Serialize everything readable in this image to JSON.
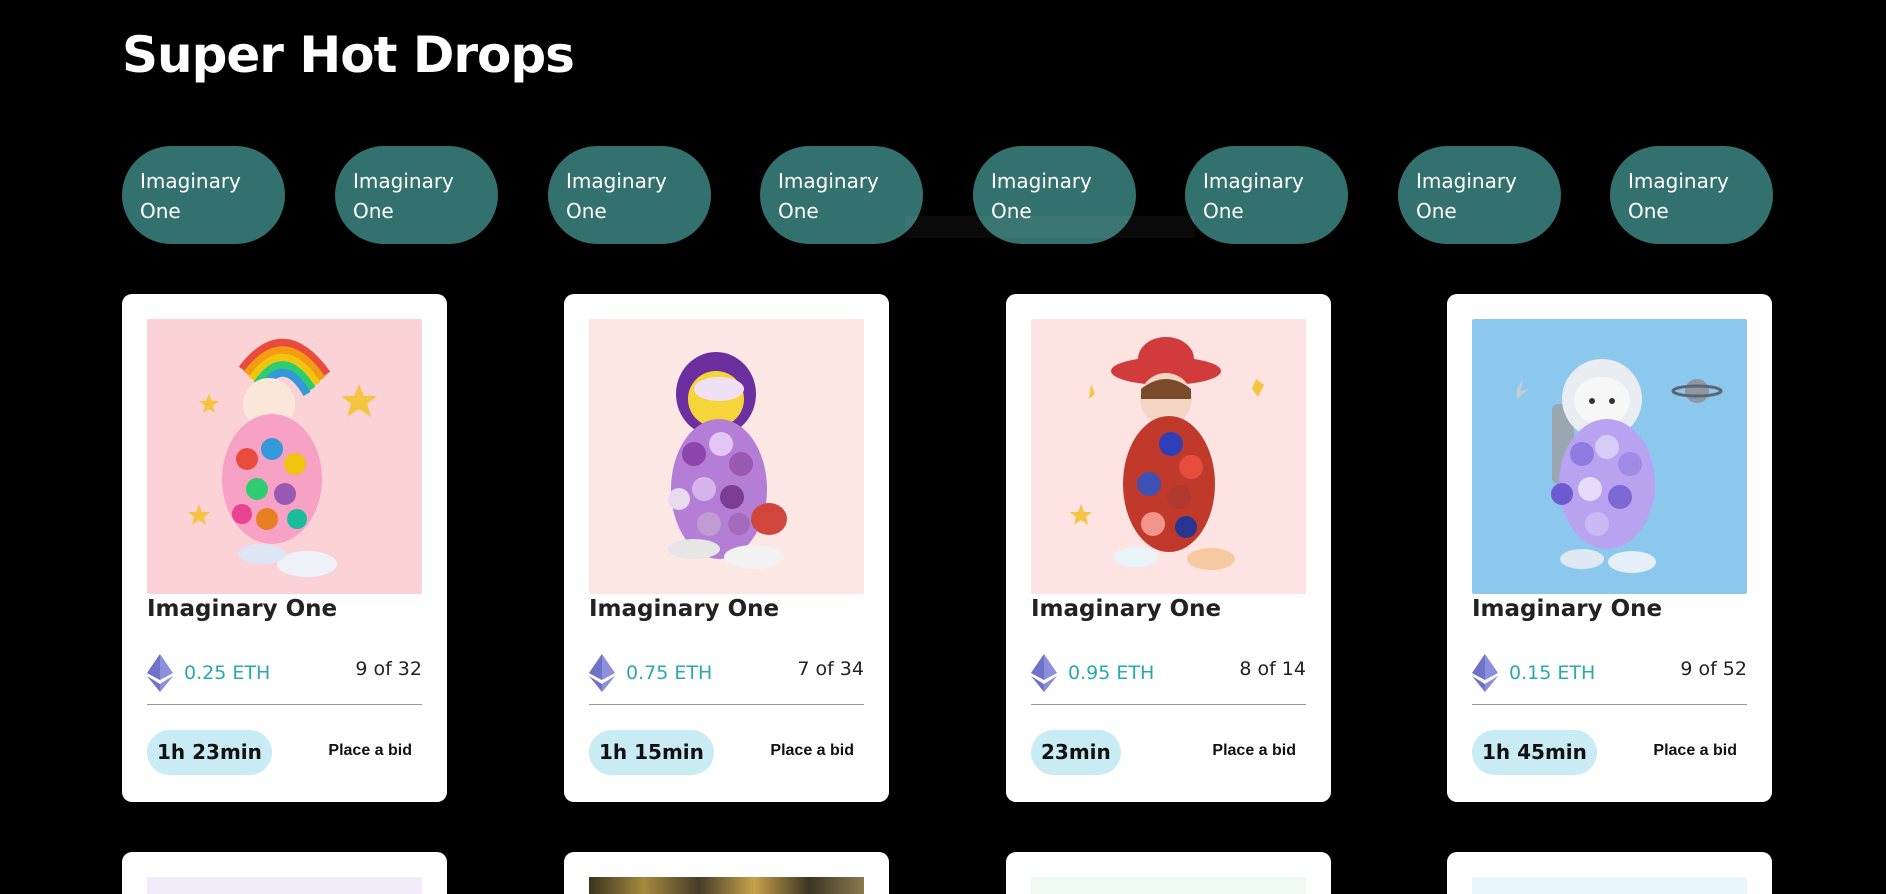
{
  "page": {
    "title": "Super Hot Drops"
  },
  "filters": [
    {
      "label": "Imaginary One"
    },
    {
      "label": "Imaginary One"
    },
    {
      "label": "Imaginary One"
    },
    {
      "label": "Imaginary One"
    },
    {
      "label": "Imaginary One"
    },
    {
      "label": "Imaginary One"
    },
    {
      "label": "Imaginary One"
    },
    {
      "label": "Imaginary One"
    }
  ],
  "cards": [
    {
      "name": "Imaginary One",
      "price": "0.25 ETH",
      "edition": "9 of 32",
      "timer": "1h 23min",
      "bid_label": "Place a bid",
      "currency_icon": "ethereum-icon",
      "image_bg": "#fbd3d6"
    },
    {
      "name": "Imaginary One",
      "price": "0.75 ETH",
      "edition": "7 of 34",
      "timer": "1h 15min",
      "bid_label": "Place a bid",
      "currency_icon": "ethereum-icon",
      "image_bg": "#fce7e5"
    },
    {
      "name": "Imaginary One",
      "price": "0.95 ETH",
      "edition": "8 of 14",
      "timer": "23min",
      "bid_label": "Place a bid",
      "currency_icon": "ethereum-icon",
      "image_bg": "#fde3e1"
    },
    {
      "name": "Imaginary One",
      "price": "0.15 ETH",
      "edition": "9 of 52",
      "timer": "1h 45min",
      "bid_label": "Place a bid",
      "currency_icon": "ethereum-icon",
      "image_bg": "#8cc7ee"
    }
  ],
  "colors": {
    "background": "#000000",
    "pill": "#33716e",
    "price": "#2aa9ad",
    "timer_bg": "#c8ebf4"
  }
}
